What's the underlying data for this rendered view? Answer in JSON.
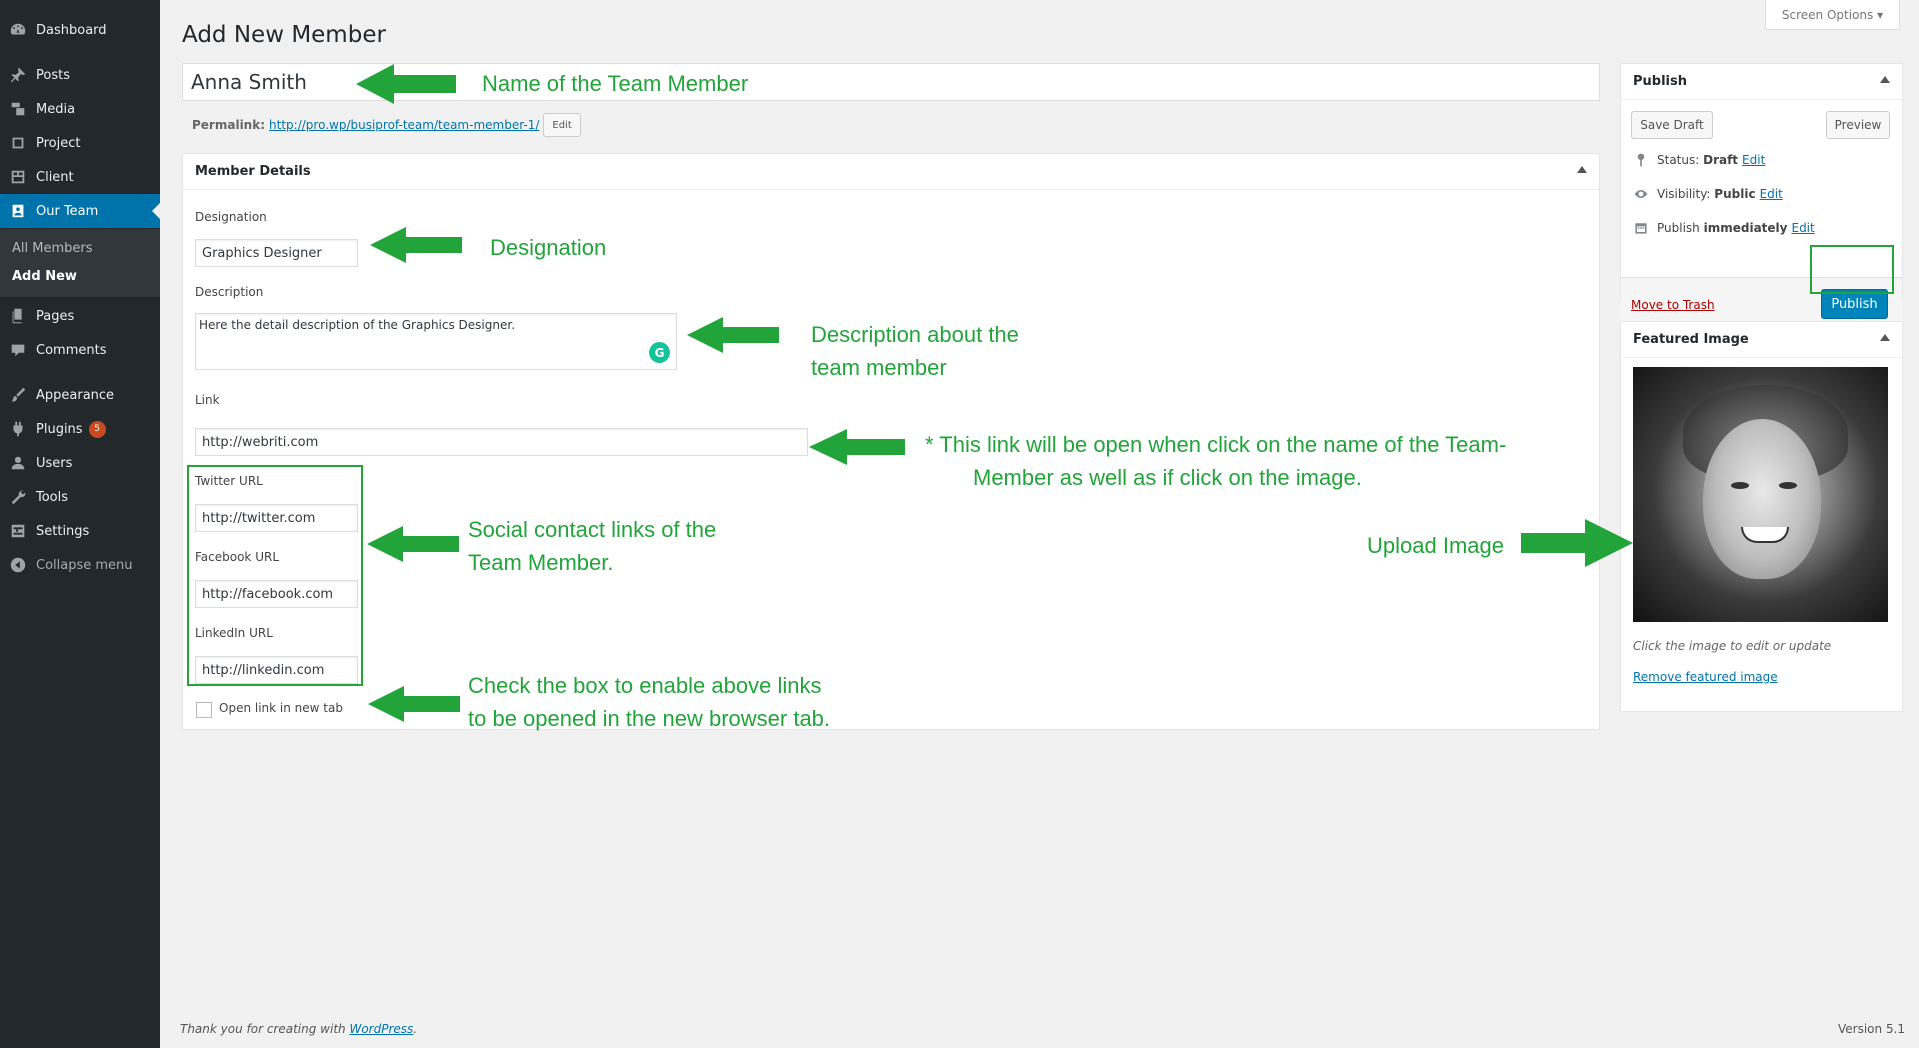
{
  "sidebar": {
    "dashboard": "Dashboard",
    "posts": "Posts",
    "media": "Media",
    "project": "Project",
    "client": "Client",
    "our_team": "Our Team",
    "sub_all_members": "All Members",
    "sub_add_new": "Add New",
    "pages": "Pages",
    "comments": "Comments",
    "appearance": "Appearance",
    "plugins": "Plugins",
    "plugins_badge": "5",
    "users": "Users",
    "tools": "Tools",
    "settings": "Settings",
    "collapse": "Collapse menu"
  },
  "header": {
    "page_title": "Add New Member",
    "screen_options": "Screen Options ▾"
  },
  "post": {
    "title_value": "Anna Smith",
    "permalink_label": "Permalink:",
    "permalink_url": "http://pro.wp/busiprof-team/team-member-1/",
    "permalink_edit": "Edit"
  },
  "member_details": {
    "heading": "Member Details",
    "designation_label": "Designation",
    "designation_value": "Graphics Designer",
    "description_label": "Description",
    "description_value": "Here the detail description of the Graphics Designer.",
    "link_label": "Link",
    "link_value": "http://webriti.com",
    "twitter_label": "Twitter URL",
    "twitter_value": "http://twitter.com",
    "facebook_label": "Facebook URL",
    "facebook_value": "http://facebook.com",
    "linkedin_label": "LinkedIn URL",
    "linkedin_value": "http://linkedin.com",
    "new_tab_label": "Open link in new tab",
    "new_tab_checked": false
  },
  "publish": {
    "heading": "Publish",
    "save_draft": "Save Draft",
    "preview": "Preview",
    "status_label": "Status:",
    "status_value": "Draft",
    "visibility_label": "Visibility:",
    "visibility_value": "Public",
    "publish_label": "Publish",
    "publish_value": "immediately",
    "edit": "Edit",
    "move_to_trash": "Move to Trash",
    "publish_button": "Publish"
  },
  "featured_image": {
    "heading": "Featured Image",
    "hint": "Click the image to edit or update",
    "remove": "Remove featured image"
  },
  "annotations": {
    "name": "Name of the Team Member",
    "designation": "Designation",
    "description_line1": "Description about the",
    "description_line2": "team member",
    "link_line1": "* This link will be open when click on the name of the Team-",
    "link_line2": "Member as well as if click on the image.",
    "social_line1": "Social contact links of the",
    "social_line2": "Team Member.",
    "upload": "Upload Image",
    "checkbox_line1": "Check the box to enable above links",
    "checkbox_line2": "to be opened in the new browser tab."
  },
  "footer": {
    "thanks_prefix": "Thank you for creating with ",
    "thanks_link": "WordPress",
    "thanks_suffix": ".",
    "version": "Version 5.1"
  },
  "colors": {
    "sidebar_bg": "#23282d",
    "accent": "#0073aa",
    "annotation_green": "#22a43a",
    "publish_button": "#0085ba"
  }
}
